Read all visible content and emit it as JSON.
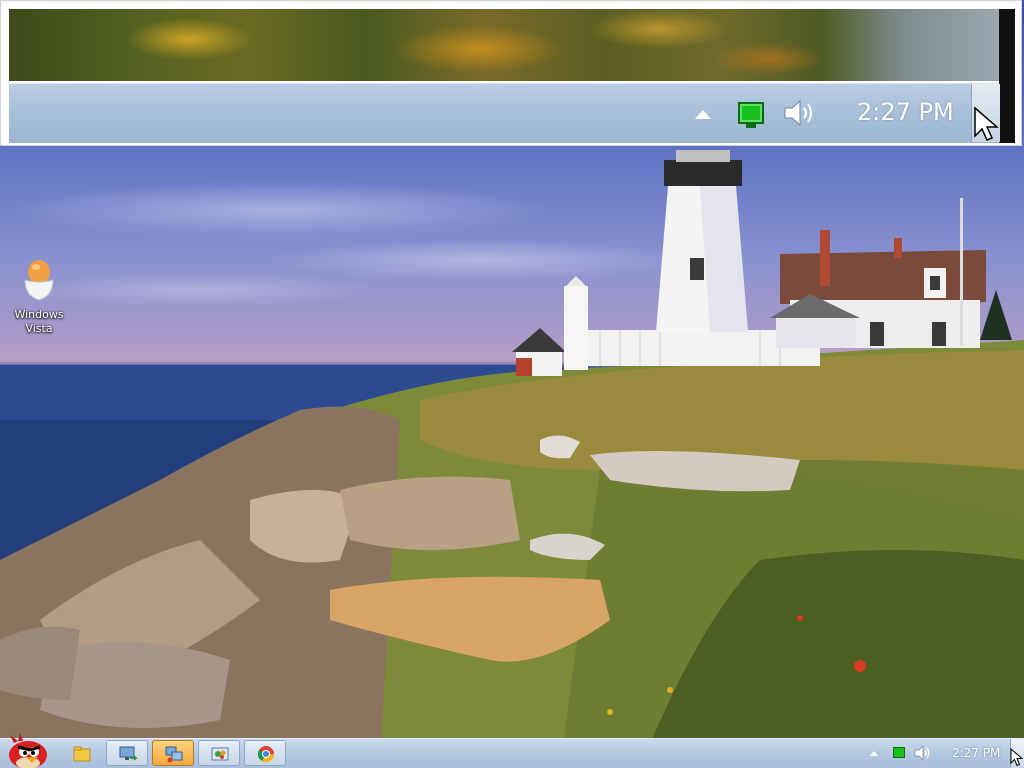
{
  "desktop": {
    "icons": [
      {
        "label": "Windows\nVista",
        "icon": "egg-cup-icon"
      }
    ]
  },
  "zoom_inset": {
    "tray": {
      "clock": "2:27 PM",
      "icons": [
        "show-hidden-icons-arrow",
        "network-icon",
        "volume-icon"
      ]
    }
  },
  "taskbar": {
    "start": {
      "icon": "angry-bird-start-orb-icon"
    },
    "buttons": [
      {
        "name": "windows-explorer",
        "icon": "folder-icon",
        "state": "pinned"
      },
      {
        "name": "remote-desktop",
        "icon": "remote-desktop-icon",
        "state": "normal"
      },
      {
        "name": "remote-assistance",
        "icon": "remote-assistance-icon",
        "state": "active"
      },
      {
        "name": "control-panel",
        "icon": "control-panel-icon",
        "state": "normal"
      },
      {
        "name": "google-chrome",
        "icon": "chrome-icon",
        "state": "normal"
      }
    ],
    "tray": {
      "clock": "2:27 PM",
      "icons": [
        "show-hidden-icons-arrow",
        "network-icon",
        "volume-icon"
      ]
    }
  },
  "colors": {
    "taskbar": "#b4c9e0",
    "active_button": "#f3a83c",
    "network_green": "#18c020"
  }
}
